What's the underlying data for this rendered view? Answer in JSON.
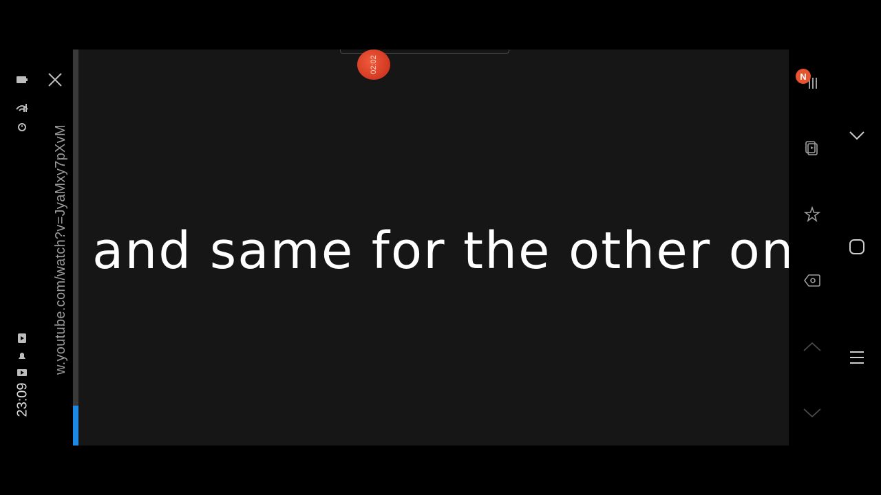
{
  "status_bar": {
    "time": "23:09",
    "icons": [
      "battery-icon",
      "wifi-signal-icon",
      "alarm-icon",
      "media-icon",
      "notification-icon",
      "cast-icon"
    ]
  },
  "browser": {
    "url": "w.youtube.com/watch?v=JyaMxy7pXvM",
    "close_icon": "close-icon"
  },
  "video": {
    "caption": "and same for the other one",
    "progress_fraction": 0.1
  },
  "recorder": {
    "elapsed": "02:02"
  },
  "edge_panel": {
    "badge": "N",
    "tools": [
      "pause-icon",
      "screenshot-icon",
      "pin-star-icon",
      "eraser-icon",
      "scroll-up-icon",
      "scroll-down-icon"
    ]
  },
  "navigation": {
    "buttons": [
      "chevron-down-icon",
      "home-icon",
      "menu-icon"
    ]
  },
  "colors": {
    "accent": "#1e88e5",
    "record": "#e8532f",
    "background": "#161616"
  }
}
